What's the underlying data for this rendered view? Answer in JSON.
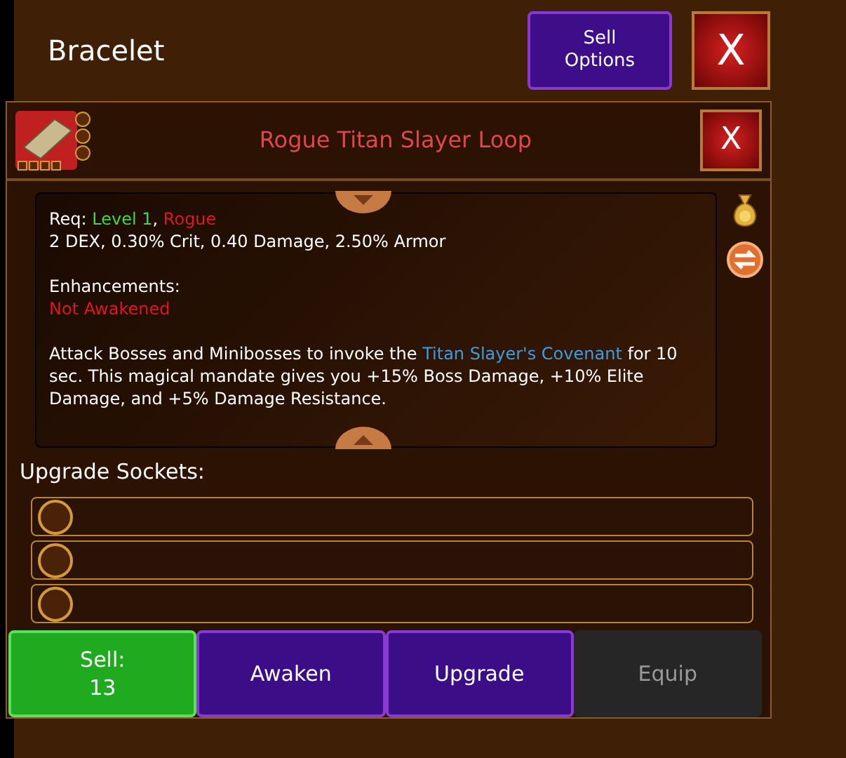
{
  "header": {
    "title": "Bracelet",
    "sell_options": "Sell\nOptions",
    "close": "X"
  },
  "item": {
    "name": "Rogue Titan Slayer Loop",
    "close": "X",
    "requirements": [
      {
        "text": "Req: ",
        "color": "#ffffff"
      },
      {
        "text": "Level 1",
        "color": "#3fd93a"
      },
      {
        "text": ", ",
        "color": "#ffffff"
      },
      {
        "text": "Rogue",
        "color": "#e01818"
      }
    ],
    "stats": "2 DEX, 0.30% Crit, 0.40 Damage, 2.50% Armor",
    "enhancements_label": "Enhancements:",
    "enhancement_status": "Not Awakened",
    "description": [
      {
        "text": "Attack Bosses and Minibosses to invoke the ",
        "color": "#ffffff"
      },
      {
        "text": "Titan Slayer's Covenant",
        "color": "#3a9ee0"
      },
      {
        "text": " for 10 sec. This magical mandate gives you +15% Boss Damage, +10% Elite Damage, and +5% Damage Resistance.",
        "color": "#ffffff"
      }
    ]
  },
  "sockets_label": "Upgrade Sockets:",
  "sockets": [
    {
      "filled": false
    },
    {
      "filled": false
    },
    {
      "filled": false
    }
  ],
  "buttons": [
    {
      "label": "Sell:\n13",
      "kind": "sell",
      "disabled": false
    },
    {
      "label": "Awaken",
      "kind": "action",
      "disabled": false
    },
    {
      "label": "Upgrade",
      "kind": "action",
      "disabled": false
    },
    {
      "label": "Equip",
      "kind": "action",
      "disabled": true
    }
  ]
}
